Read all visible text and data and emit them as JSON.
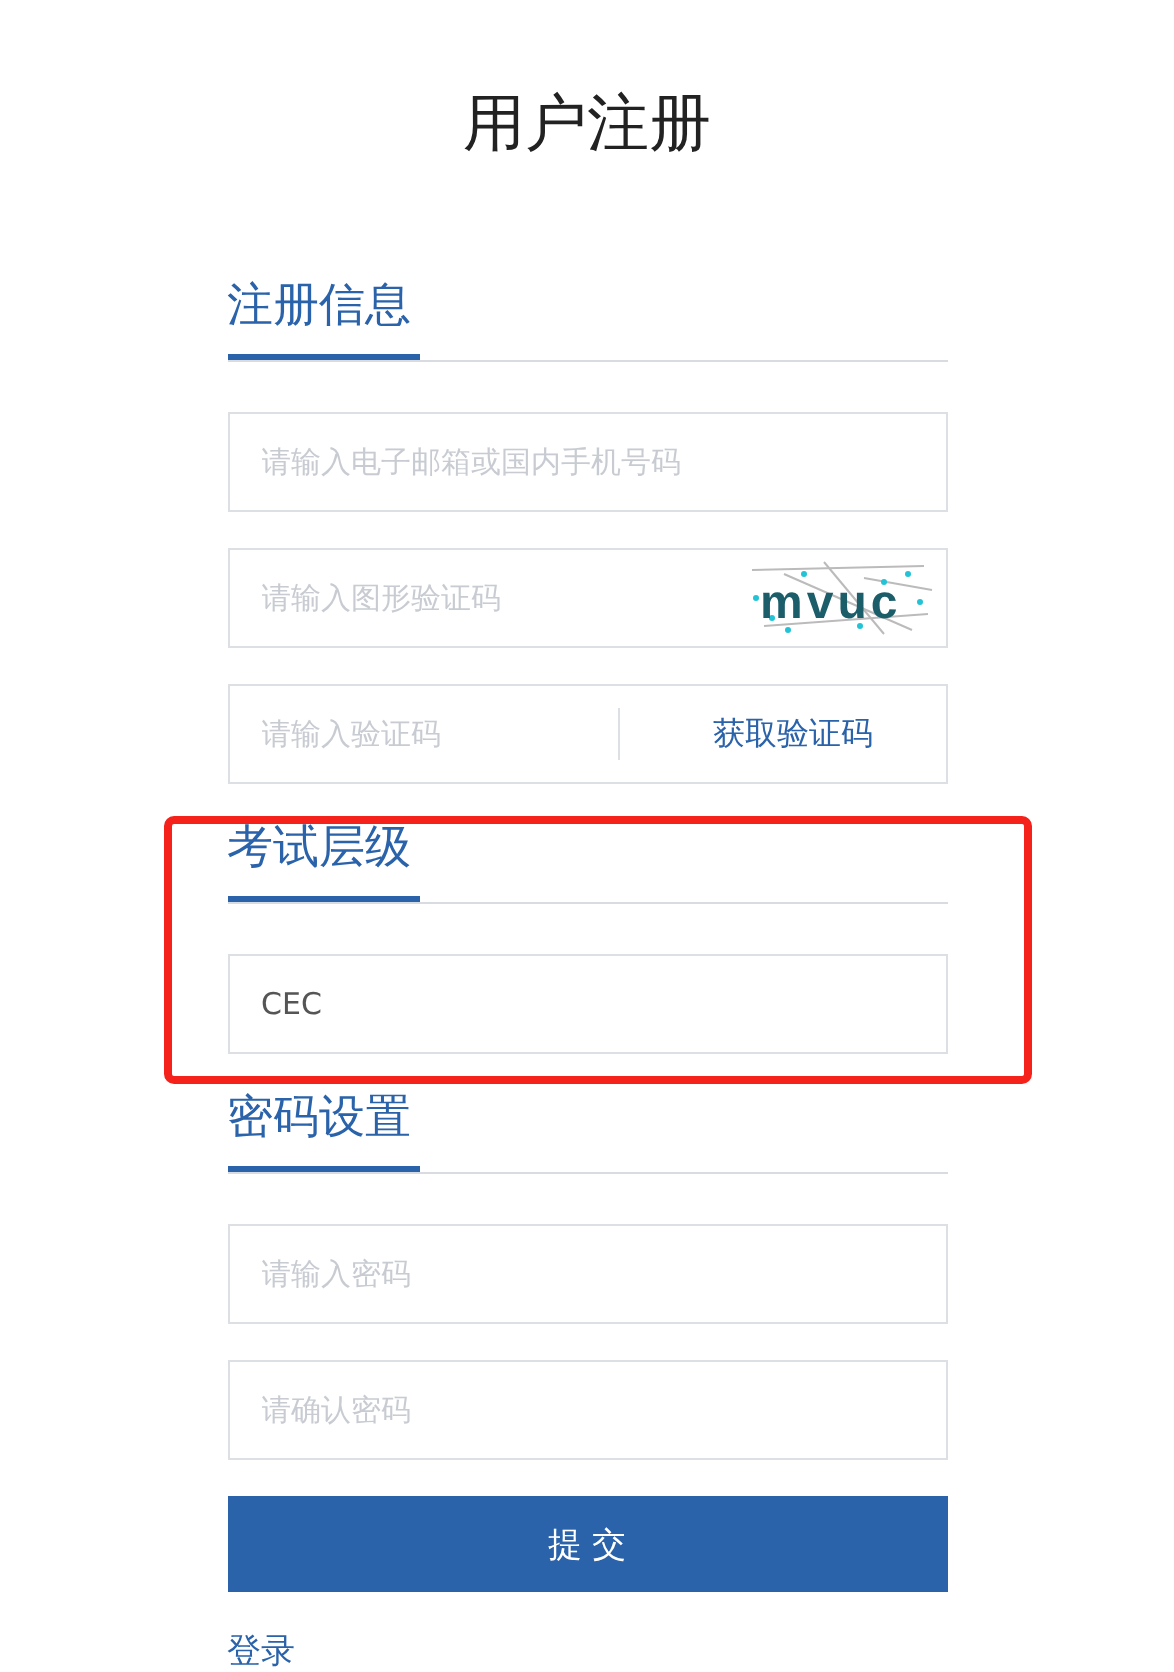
{
  "title": "用户注册",
  "sections": [
    {
      "heading": "注册信息",
      "highlighted": false,
      "fields": [
        {
          "kind": "text",
          "placeholder": "请输入电子邮箱或国内手机号码"
        },
        {
          "kind": "captcha",
          "placeholder": "请输入图形验证码",
          "captcha": "mvuc"
        },
        {
          "kind": "code",
          "placeholder": "请输入验证码",
          "action": "获取验证码"
        }
      ]
    },
    {
      "heading": "考试层级",
      "highlighted": true,
      "fields": [
        {
          "kind": "text",
          "value": "CEC"
        }
      ]
    },
    {
      "heading": "密码设置",
      "highlighted": false,
      "fields": [
        {
          "kind": "password",
          "placeholder": "请输入密码"
        },
        {
          "kind": "password",
          "placeholder": "请确认密码"
        }
      ]
    }
  ],
  "submit": "提 交",
  "login_link": "登录"
}
